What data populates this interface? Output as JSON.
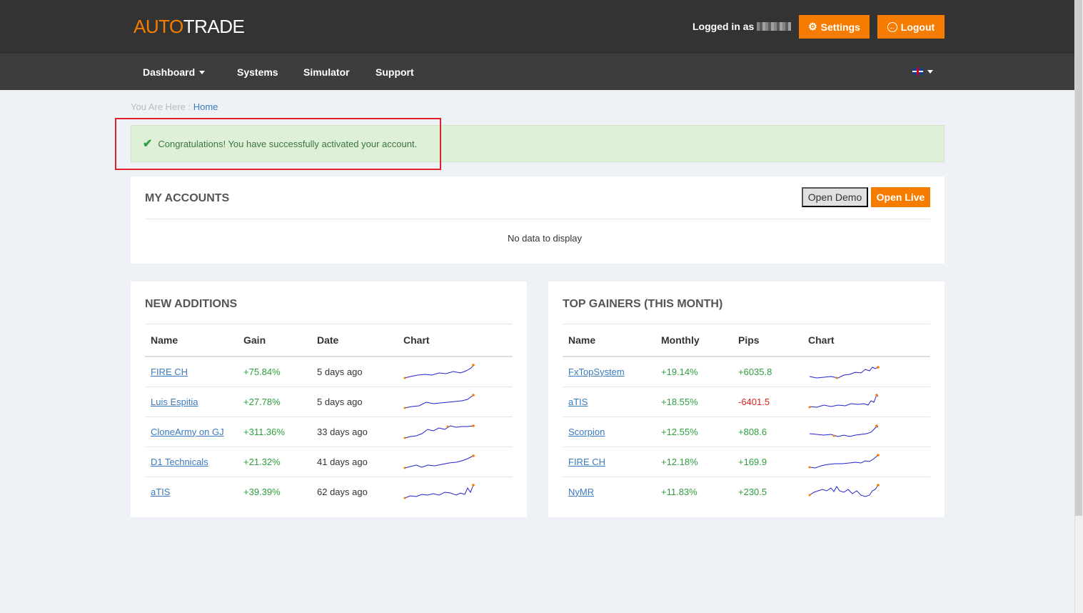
{
  "header": {
    "logo_part1": "AUTO",
    "logo_part2": "TRADE",
    "logged_in_label": "Logged in as",
    "settings_label": "Settings",
    "logout_label": "Logout"
  },
  "nav": {
    "items": [
      {
        "label": "Dashboard"
      },
      {
        "label": "Systems"
      },
      {
        "label": "Simulator"
      },
      {
        "label": "Support"
      }
    ]
  },
  "breadcrumb": {
    "prefix": "You Are Here :",
    "current": "Home"
  },
  "alert": {
    "message": "Congratulations! You have successfully activated your account."
  },
  "my_accounts": {
    "title": "MY ACCOUNTS",
    "open_demo_label": "Open Demo",
    "open_live_label": "Open Live",
    "empty_text": "No data to display"
  },
  "new_additions": {
    "title": "NEW ADDITIONS",
    "headers": [
      "Name",
      "Gain",
      "Date",
      "Chart"
    ],
    "rows": [
      {
        "name": "FIRE CH",
        "gain": "+75.84%",
        "date": "5 days ago"
      },
      {
        "name": "Luis Espitia",
        "gain": "+27.78%",
        "date": "5 days ago"
      },
      {
        "name": "CloneArmy on GJ",
        "gain": "+311.36%",
        "date": "33 days ago"
      },
      {
        "name": "D1 Technicals",
        "gain": "+21.32%",
        "date": "41 days ago"
      },
      {
        "name": "aTIS",
        "gain": "+39.39%",
        "date": "62 days ago"
      }
    ]
  },
  "top_gainers": {
    "title": "TOP GAINERS (THIS MONTH)",
    "headers": [
      "Name",
      "Monthly",
      "Pips",
      "Chart"
    ],
    "rows": [
      {
        "name": "FxTopSystem",
        "monthly": "+19.14%",
        "pips": "+6035.8"
      },
      {
        "name": "aTIS",
        "monthly": "+18.55%",
        "pips": "-6401.5"
      },
      {
        "name": "Scorpion",
        "monthly": "+12.55%",
        "pips": "+808.6"
      },
      {
        "name": "FIRE CH",
        "monthly": "+12.18%",
        "pips": "+169.9"
      },
      {
        "name": "NyMR",
        "monthly": "+11.83%",
        "pips": "+230.5"
      }
    ]
  },
  "colors": {
    "accent": "#f57c00",
    "positive": "#2e9e3e",
    "negative": "#e02020",
    "sparkline": "#2222cc"
  }
}
